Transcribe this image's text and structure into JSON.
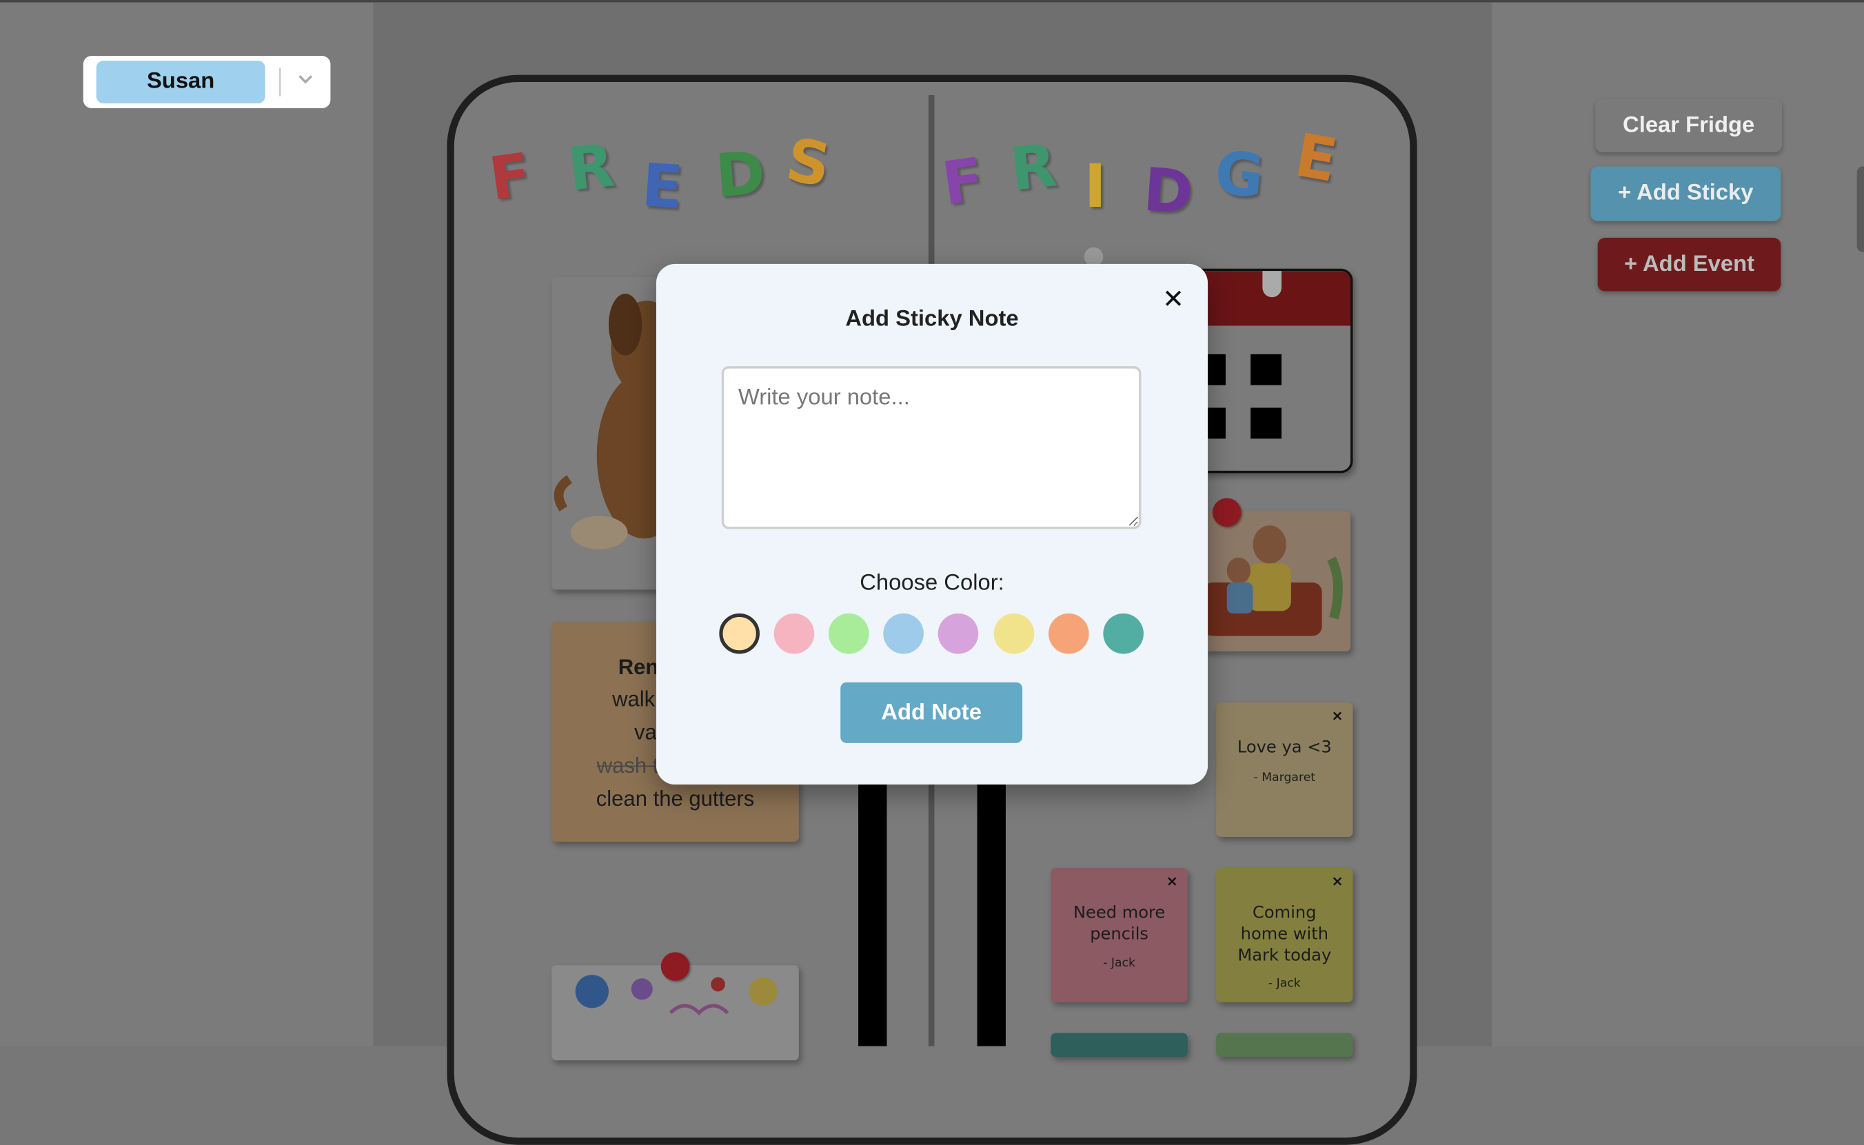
{
  "user_select": {
    "selected": "Susan",
    "chevron_icon": "chevron-down-icon"
  },
  "actions": {
    "clear_fridge": "Clear Fridge",
    "add_sticky": "+ Add Sticky",
    "add_event": "+ Add Event"
  },
  "fridge": {
    "magnets_left": [
      {
        "char": "F",
        "color": "#c0272d"
      },
      {
        "char": "R",
        "color": "#2e9e6b"
      },
      {
        "char": "E",
        "color": "#2f5fc4"
      },
      {
        "char": "D",
        "color": "#2d8f3c"
      },
      {
        "char": "S",
        "color": "#e79a16"
      }
    ],
    "magnets_right": [
      {
        "char": "F",
        "color": "#8b35b8"
      },
      {
        "char": "R",
        "color": "#2e9e6b"
      },
      {
        "char": "I",
        "color": "#e9b21a"
      },
      {
        "char": "D",
        "color": "#6a22a0"
      },
      {
        "char": "G",
        "color": "#2f79c4"
      },
      {
        "char": "E",
        "color": "#e07a16"
      }
    ],
    "reminder": {
      "title": "Ren",
      "lines": [
        "walk",
        "va",
        "wash t",
        "clean the gutters"
      ]
    },
    "stickies": [
      {
        "text": "Love ya <3",
        "author": "- Margaret",
        "color": "#8c8060"
      },
      {
        "text": "Need more pencils",
        "author": "- Jack",
        "color": "#8b5a63"
      },
      {
        "text": "Coming home with Mark today",
        "author": "- Jack",
        "color": "#83803f"
      }
    ],
    "sticky_close": "×"
  },
  "dialog": {
    "title": "Add Sticky Note",
    "close": "✕",
    "placeholder": "Write your note...",
    "note_value": "",
    "choose_color_label": "Choose Color:",
    "colors": [
      "#ffe0a8",
      "#f6b3c0",
      "#a8ec9a",
      "#9dcbe9",
      "#d7a3dc",
      "#f0e38b",
      "#f6a377",
      "#52ada2"
    ],
    "selected_color": "#ffe0a8",
    "submit": "Add Note"
  }
}
